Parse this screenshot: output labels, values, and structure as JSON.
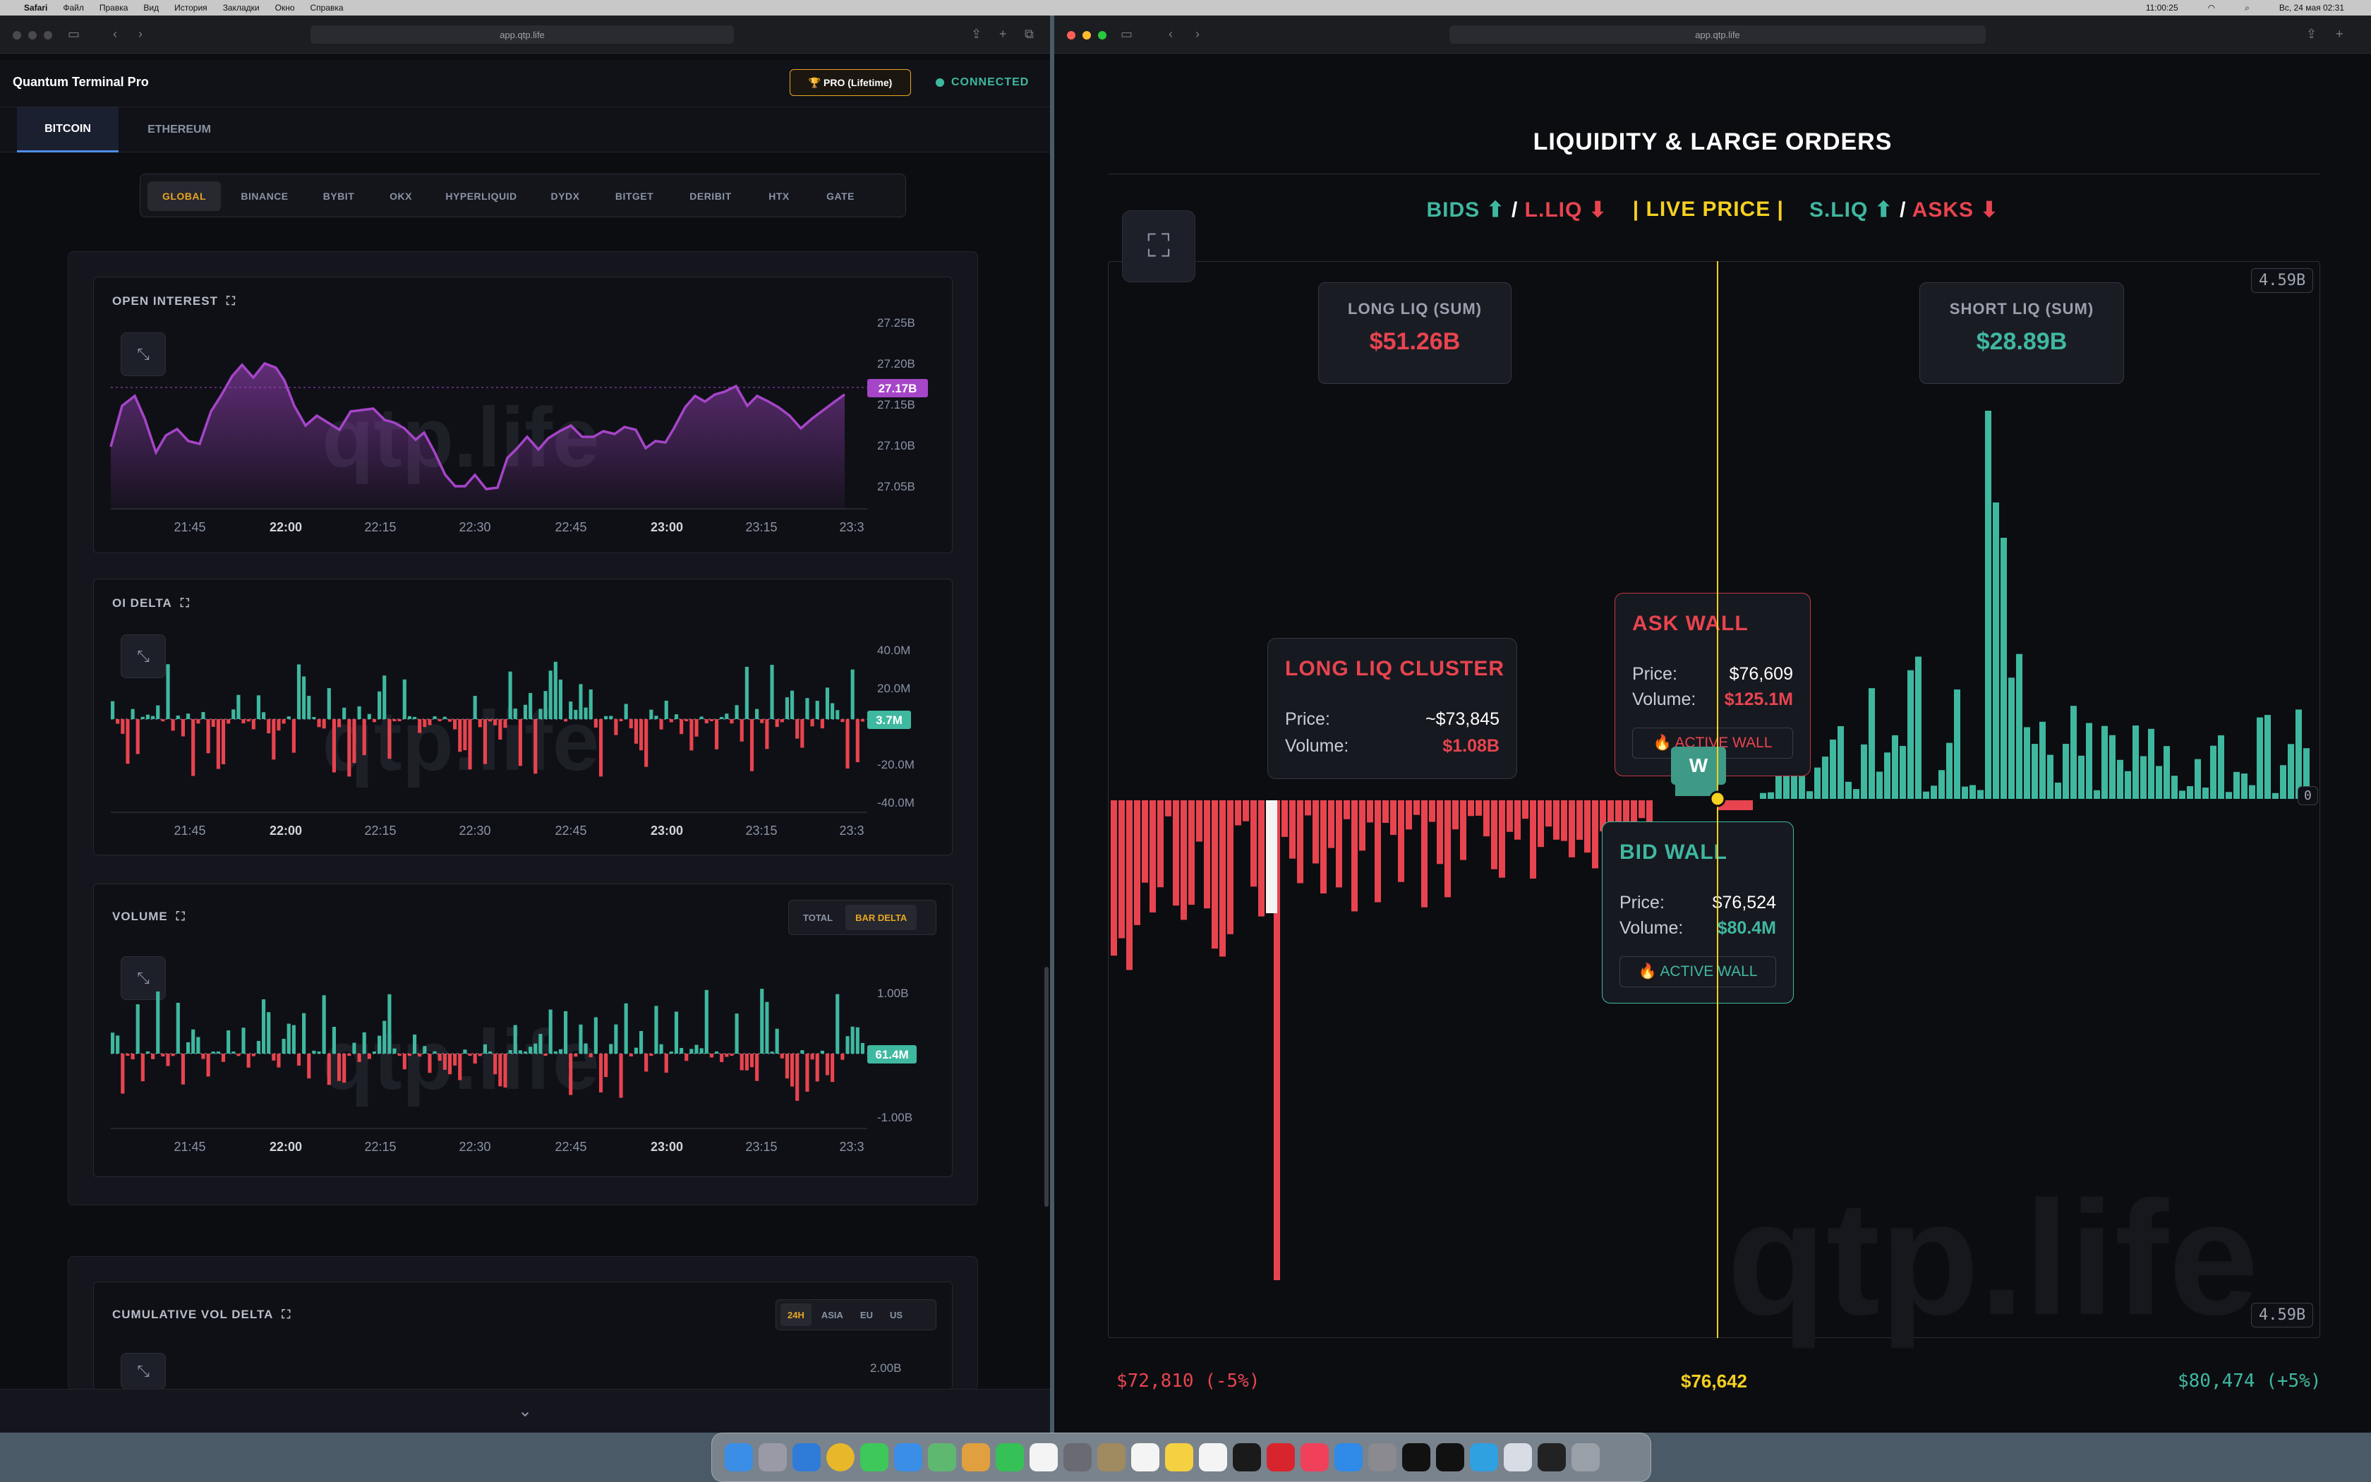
{
  "menubar": {
    "items": [
      "Safari",
      "Файл",
      "Правка",
      "Вид",
      "История",
      "Закладки",
      "Окно",
      "Справка"
    ],
    "time": "11:00:25",
    "clock": "Вс, 24 мая 02:31"
  },
  "left_window": {
    "url": "app.qtp.life",
    "app_title": "Quantum Terminal Pro",
    "pro_badge": "🏆 PRO (Lifetime)",
    "status": "CONNECTED",
    "asset_tabs": [
      "BITCOIN",
      "ETHEREUM"
    ],
    "exchanges": [
      "GLOBAL",
      "BINANCE",
      "BYBIT",
      "OKX",
      "HYPERLIQUID",
      "DYDX",
      "BITGET",
      "DERIBIT",
      "HTX",
      "GATE"
    ],
    "x_ticks": [
      "21:45",
      "22:00",
      "22:15",
      "22:30",
      "22:45",
      "23:00",
      "23:15",
      "23:3"
    ],
    "open_interest": {
      "title": "OPEN INTEREST",
      "y_ticks": [
        "27.25B",
        "27.20B",
        "27.15B",
        "27.10B",
        "27.05B"
      ],
      "current": "27.17B"
    },
    "oi_delta": {
      "title": "OI DELTA",
      "y_ticks": [
        "40.0M",
        "20.0M",
        "-20.0M",
        "-40.0M"
      ],
      "current": "3.7M"
    },
    "volume": {
      "title": "VOLUME",
      "modes": [
        "TOTAL",
        "BAR DELTA"
      ],
      "y_ticks": [
        "1.00B",
        "-1.00B"
      ],
      "current": "61.4M"
    },
    "cvd": {
      "title": "CUMULATIVE VOL DELTA",
      "sessions": [
        "24H",
        "ASIA",
        "EU",
        "US"
      ],
      "y_ticks": [
        "2.00B"
      ]
    },
    "watermark": "qtp.life"
  },
  "right_window": {
    "url": "app.qtp.life",
    "title": "LIQUIDITY & LARGE ORDERS",
    "legend": {
      "bids": "BIDS ⬆",
      "sep1": "/",
      "lliq": "L.LIQ ⬇",
      "live": "| LIVE PRICE |",
      "sliq": "S.LIQ ⬆",
      "sep2": "/",
      "asks": "ASKS ⬇"
    },
    "scale_top": "4.59B",
    "scale_bottom": "4.59B",
    "zero": "0",
    "long_liq_sum": {
      "label": "LONG LIQ (SUM)",
      "value": "$51.26B"
    },
    "short_liq_sum": {
      "label": "SHORT LIQ (SUM)",
      "value": "$28.89B"
    },
    "long_liq_cluster": {
      "title": "LONG LIQ CLUSTER",
      "price_label": "Price:",
      "price": "~$73,845",
      "volume_label": "Volume:",
      "volume": "$1.08B"
    },
    "ask_wall": {
      "title": "ASK WALL",
      "price_label": "Price:",
      "price": "$76,609",
      "volume_label": "Volume:",
      "volume": "$125.1M",
      "badge": "🔥 ACTIVE WALL"
    },
    "bid_wall": {
      "title": "BID WALL",
      "price_label": "Price:",
      "price": "$76,524",
      "volume_label": "Volume:",
      "volume": "$80.4M",
      "badge": "🔥 ACTIVE WALL"
    },
    "wall_marker": "W",
    "price_low": "$72,810 (-5%)",
    "price_live": "$76,642",
    "price_high": "$80,474 (+5%)",
    "watermark": "qtp.life"
  },
  "colors": {
    "bull": "#3fb8a0",
    "bear": "#e8444f",
    "accent": "#e8a622",
    "live": "#f5d020",
    "oi": "#a545c8"
  }
}
